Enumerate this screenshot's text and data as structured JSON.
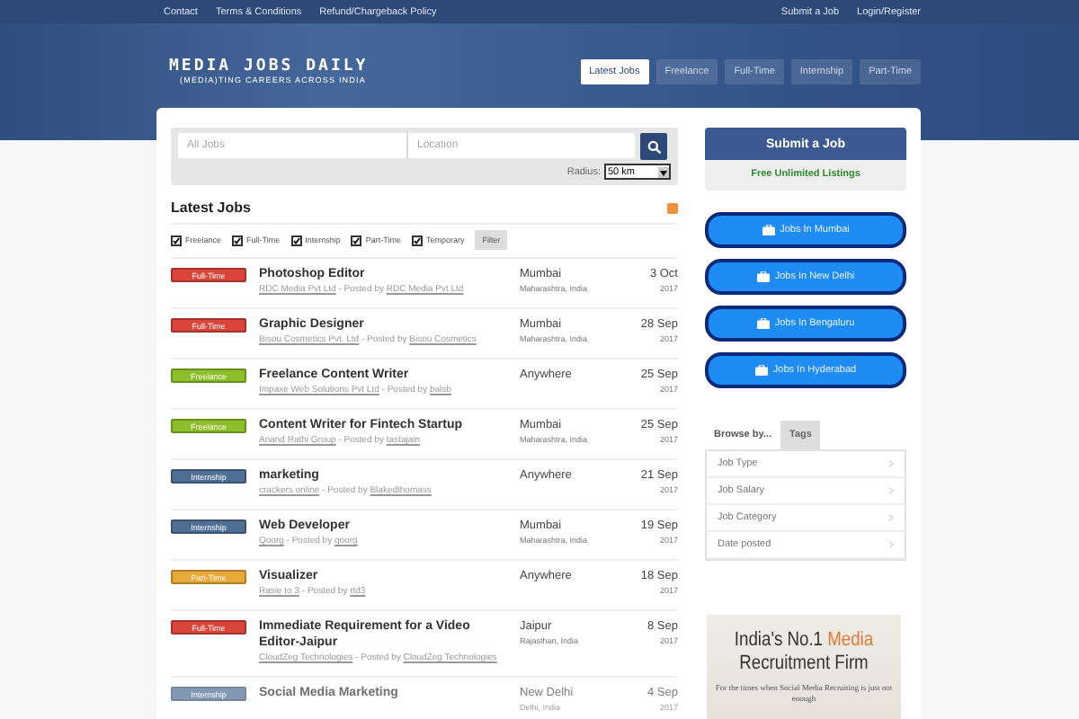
{
  "top_links": [
    "Contact",
    "Terms & Conditions",
    "Refund/Chargeback Policy"
  ],
  "top_links_right": [
    "Submit a Job",
    "Login/Register"
  ],
  "logo": {
    "title": "MEDIA JOBS DAILY",
    "tagline": "(MEDIA)TING CAREERS ACROSS INDIA"
  },
  "nav": [
    {
      "label": "Latest Jobs",
      "selected": true
    },
    {
      "label": "Freelance",
      "selected": false
    },
    {
      "label": "Full-Time",
      "selected": false
    },
    {
      "label": "Internship",
      "selected": false
    },
    {
      "label": "Part-Time",
      "selected": false
    }
  ],
  "search": {
    "keywords_placeholder": "All Jobs",
    "location_placeholder": "Location",
    "radius_label": "Radius:",
    "radius_value": "50 km"
  },
  "section_title": "Latest Jobs",
  "filters": [
    {
      "label": "Freelance",
      "checked": true
    },
    {
      "label": "Full-Time",
      "checked": true
    },
    {
      "label": "Internship",
      "checked": true
    },
    {
      "label": "Part-Time",
      "checked": true
    },
    {
      "label": "Temporary",
      "checked": true
    }
  ],
  "filter_button": "Filter",
  "jobs": [
    {
      "type": "Full-Time",
      "kind": "fulltime",
      "title": "Photoshop Editor",
      "company": "RDC Media Pvt Ltd",
      "posted_by_label": "- Posted by",
      "poster": "RDC Media Pvt Ltd",
      "location": "Mumbai",
      "region": "Maharashtra, India",
      "date": "3 Oct",
      "year": "2017",
      "faded": false
    },
    {
      "type": "Full-Time",
      "kind": "fulltime",
      "title": "Graphic Designer",
      "company": "Bisou Cosmetics Pvt. Ltd",
      "posted_by_label": "- Posted by",
      "poster": "Bisou Cosmetics",
      "location": "Mumbai",
      "region": "Maharashtra, India",
      "date": "28 Sep",
      "year": "2017",
      "faded": false
    },
    {
      "type": "Freelance",
      "kind": "freelance",
      "title": "Freelance Content Writer",
      "company": "Impaxe Web Solutions Pvt Ltd",
      "posted_by_label": "- Posted by",
      "poster": "balsb",
      "location": "Anywhere",
      "date": "25 Sep",
      "year": "2017",
      "faded": false
    },
    {
      "type": "Freelance",
      "kind": "freelance",
      "title": "Content Writer for Fintech Startup",
      "company": "Anand Rathi Group",
      "posted_by_label": "- Posted by",
      "poster": "tastajain",
      "location": "Mumbai",
      "region": "Maharashtra, India",
      "date": "25 Sep",
      "year": "2017",
      "faded": false
    },
    {
      "type": "Internship",
      "kind": "internship",
      "title": "marketing",
      "company": "crackers online",
      "posted_by_label": "- Posted by",
      "poster": "Blakedthomass",
      "location": "Anywhere",
      "date": "21 Sep",
      "year": "2017",
      "faded": false
    },
    {
      "type": "Internship",
      "kind": "internship",
      "title": "Web Developer",
      "company": "Qoorg",
      "posted_by_label": "- Posted by",
      "poster": "qoorg",
      "location": "Mumbai",
      "region": "Maharashtra, India",
      "date": "19 Sep",
      "year": "2017",
      "faded": false
    },
    {
      "type": "Part-Time",
      "kind": "parttime",
      "title": "Visualizer",
      "company": "Rasie to 3",
      "posted_by_label": "- Posted by",
      "poster": "rtd3",
      "location": "Anywhere",
      "date": "18 Sep",
      "year": "2017",
      "faded": false
    },
    {
      "type": "Full-Time",
      "kind": "fulltime",
      "title": "Immediate Requirement for a Video Editor-Jaipur",
      "company": "CloudZeg Technologies",
      "posted_by_label": "- Posted by",
      "poster": "CloudZeg Technologies",
      "location": "Jaipur",
      "region": "Rajasthan, India",
      "date": "8 Sep",
      "year": "2017",
      "faded": false
    },
    {
      "type": "Internship",
      "kind": "internship",
      "title": "Social Media Marketing",
      "location": "New Delhi",
      "region": "Delhi, India",
      "date": "4 Sep",
      "year": "2017",
      "faded": true
    }
  ],
  "sidebar": {
    "submit_button": "Submit a Job",
    "submit_note": "Free Unlimited Listings",
    "city_buttons": [
      "Jobs In Mumbai",
      "Jobs In New Delhi",
      "Jobs In Bengaluru",
      "Jobs In Hyderabad"
    ],
    "browse_tabs": [
      {
        "label": "Browse by...",
        "selected": true
      },
      {
        "label": "Tags",
        "selected": false
      }
    ],
    "browse_items": [
      "Job Type",
      "Job Salary",
      "Job Category",
      "Date posted"
    ],
    "ad": {
      "headline_start": "India's No.1",
      "headline_highlight": "Media",
      "headline_end": "Recruitment Firm",
      "subline": "For the times when Social Media Recruiting is just not enough"
    }
  }
}
